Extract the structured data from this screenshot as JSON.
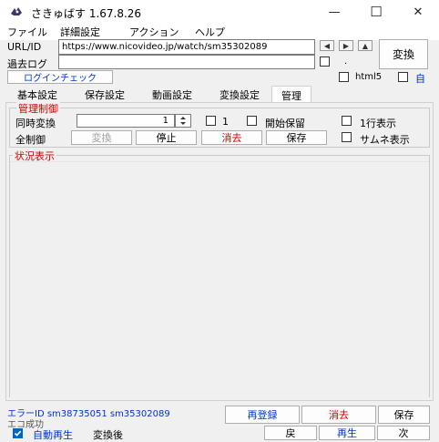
{
  "window": {
    "title": "さきゅばす  1.67.8.26",
    "minimize": "—",
    "maximize": "☐",
    "close": "✕"
  },
  "menu": [
    "ファイル",
    "詳細設定",
    "アクション",
    "ヘルプ"
  ],
  "url_row": {
    "label": "URL/ID",
    "value": "https://www.nicovideo.jp/watch/sm35302089",
    "nav_prev": "◀",
    "nav_next": "▶",
    "nav_up": "▲"
  },
  "history_row": {
    "label": "過去ログ",
    "value": "",
    "dot": "."
  },
  "convert_button": "変換",
  "login_button": "ログインチェック",
  "html5": {
    "label": "html5",
    "checked": false
  },
  "auto": {
    "label": "自",
    "checked": false
  },
  "tabs": [
    "基本設定",
    "保存設定",
    "動画設定",
    "変換設定",
    "管理"
  ],
  "active_tab": "管理",
  "management": {
    "legend": "管理制御",
    "concurrent_label": "同時変換",
    "concurrent_value": "1",
    "check_one": {
      "label": "1",
      "checked": false
    },
    "start_hold": {
      "label": "開始保留",
      "checked": false
    },
    "one_line": {
      "label": "1行表示",
      "checked": false
    },
    "all_control_label": "全制御",
    "buttons": {
      "convert": "変換",
      "stop": "停止",
      "delete": "消去",
      "save": "保存"
    },
    "thumbnail": {
      "label": "サムネ表示",
      "checked": false
    }
  },
  "status": {
    "legend": "状況表示"
  },
  "footer": {
    "error_line": "エラーID  sm38735051   sm35302089",
    "eco_line": "エコ成功",
    "autoplay": {
      "label": "自動再生",
      "checked": true
    },
    "after_convert": "変換後",
    "buttons": {
      "reregister": "再登録",
      "delete": "消去",
      "save": "保存",
      "back": "戻",
      "play": "再生",
      "next": "次"
    }
  },
  "colors": {
    "accent": "#0067c0",
    "danger": "#d00000",
    "link": "#0033cc"
  }
}
